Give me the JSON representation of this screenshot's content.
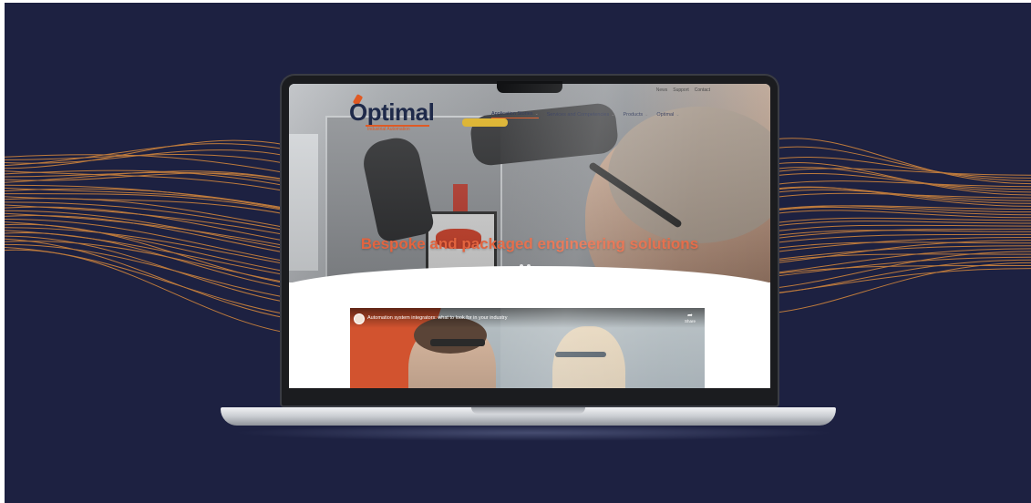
{
  "colors": {
    "background": "#1d2141",
    "accent": "#e3643f",
    "wire": "#d98a3c",
    "logo_navy": "#1f2a4a"
  },
  "site": {
    "logo": {
      "wordmark": "Optimal",
      "tagline": "Industrial Automation"
    },
    "top_links": [
      "News",
      "Support",
      "Contact"
    ],
    "nav": [
      {
        "label": "Application Stories",
        "icon": "chevron-down-icon"
      },
      {
        "label": "Services and Competencies",
        "icon": "chevron-down-icon"
      },
      {
        "label": "Products",
        "icon": "chevron-down-icon"
      },
      {
        "label": "Optimal",
        "icon": "chevron-down-icon"
      }
    ],
    "hero": {
      "headline": "Bespoke and packaged engineering solutions"
    },
    "video": {
      "title": "Automation system integrators: what to look for in your industry",
      "share_label": "Share",
      "share_icon": "share-arrow-icon"
    }
  }
}
